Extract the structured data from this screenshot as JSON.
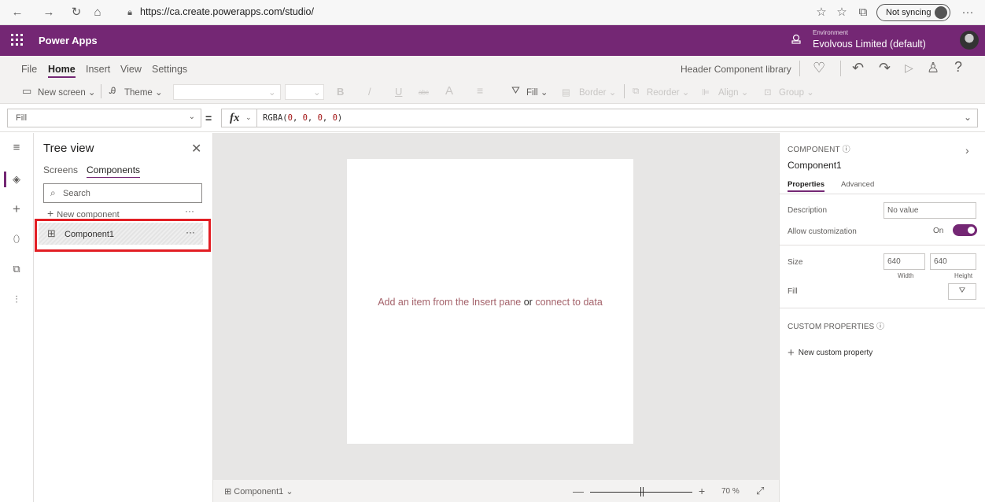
{
  "browser": {
    "url": "https://ca.create.powerapps.com/studio/",
    "sync_label": "Not syncing"
  },
  "appbar": {
    "app_name": "Power Apps",
    "env_label": "Environment",
    "env_name": "Evolvous Limited (default)"
  },
  "menu": {
    "items": [
      "File",
      "Home",
      "Insert",
      "View",
      "Settings"
    ],
    "library": "Header Component library"
  },
  "toolbar": {
    "new_screen": "New screen",
    "theme": "Theme",
    "bold": "B",
    "italic": "/",
    "underline": "U",
    "strike": "abc",
    "font_color": "A",
    "align_text": "≡",
    "fill": "Fill",
    "border": "Border",
    "reorder": "Reorder",
    "align": "Align",
    "group": "Group"
  },
  "formula": {
    "property": "Fill",
    "equals": "=",
    "fx": "fx",
    "fn": "RGBA(",
    "n1": "0",
    "n2": "0",
    "n3": "0",
    "n4": "0",
    "sep": ", ",
    "close": ")"
  },
  "tree": {
    "title": "Tree view",
    "tabs": [
      "Screens",
      "Components"
    ],
    "search_placeholder": "Search",
    "new_component": "New component",
    "component": "Component1",
    "more": "···"
  },
  "canvas": {
    "hint_a": "Add an item from the Insert pane",
    "hint_or": "or",
    "hint_link": "connect to data"
  },
  "status": {
    "component": "Component1",
    "zoom_minus": "—",
    "zoom_plus": "+",
    "zoom": "70 %"
  },
  "panel": {
    "kind": "COMPONENT",
    "name": "Component1",
    "tabs": [
      "Properties",
      "Advanced"
    ],
    "description_label": "Description",
    "description_value": "No value",
    "allow_label": "Allow customization",
    "allow_state": "On",
    "allow_on": true,
    "size_label": "Size",
    "width": "640",
    "height": "640",
    "width_label": "Width",
    "height_label": "Height",
    "fill_label": "Fill",
    "custom_label": "CUSTOM PROPERTIES",
    "new_custom": "New custom property"
  },
  "colors": {
    "brand": "#742774",
    "highlight": "#e21e24"
  }
}
